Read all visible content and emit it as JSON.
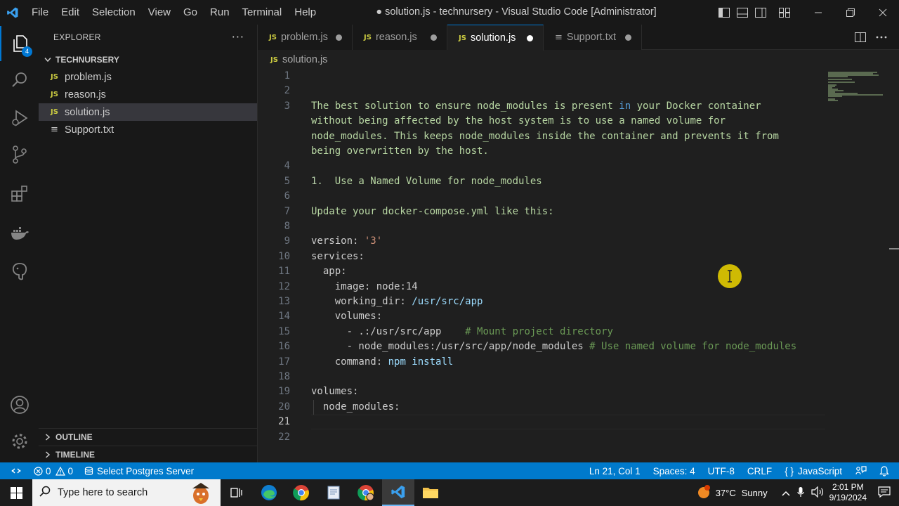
{
  "window": {
    "title": "● solution.js - technursery - Visual Studio Code [Administrator]",
    "menu": [
      "File",
      "Edit",
      "Selection",
      "View",
      "Go",
      "Run",
      "Terminal",
      "Help"
    ]
  },
  "activity_bar": {
    "explorer_badge": "4",
    "icons": [
      "files-icon",
      "search-icon",
      "run-debug-icon",
      "source-control-icon",
      "extensions-icon",
      "docker-icon",
      "postgres-icon",
      "account-icon",
      "manage-gear-icon"
    ]
  },
  "sidebar": {
    "title": "EXPLORER",
    "more": "···",
    "folder": "TECHNURSERY",
    "files": [
      {
        "icon": "JS",
        "name": "problem.js"
      },
      {
        "icon": "JS",
        "name": "reason.js"
      },
      {
        "icon": "JS",
        "name": "solution.js",
        "selected": true
      },
      {
        "icon": "≡",
        "name": "Support.txt"
      }
    ],
    "outline": "OUTLINE",
    "timeline": "TIMELINE"
  },
  "tabs": [
    {
      "icon": "JS",
      "label": "problem.js",
      "active": false
    },
    {
      "icon": "JS",
      "label": "reason.js",
      "active": false
    },
    {
      "icon": "JS",
      "label": "solution.js",
      "active": true
    },
    {
      "icon": "≡",
      "label": "Support.txt",
      "active": false
    }
  ],
  "breadcrumb": {
    "icon": "JS",
    "file": "solution.js"
  },
  "editor": {
    "current_line": 21,
    "line_numbers": [
      "1",
      "2",
      "3",
      "",
      "",
      "",
      "4",
      "5",
      "6",
      "7",
      "8",
      "9",
      "10",
      "11",
      "12",
      "13",
      "14",
      "15",
      "16",
      "17",
      "18",
      "19",
      "20",
      "21",
      "22"
    ],
    "lines": {
      "l3a": "The best solution to ensure node_modules is present ",
      "l3_in": "in",
      "l3b": " your Docker container",
      "l3c": "without being affected by the host system is to use a named volume for",
      "l3d": "node_modules. This keeps node_modules inside the container and prevents it from",
      "l3e": "being overwritten by the host.",
      "l5_num": "1.",
      "l5_text": "  Use a Named Volume for node_modules",
      "l7": "Update your docker-compose.yml like this:",
      "l9_key": "version:",
      "l9_val": " '3'",
      "l10": "services:",
      "l11": "  app:",
      "l12_key": "    image:",
      "l12_val": " node:14",
      "l13_key": "    working_dir:",
      "l13_val": " /usr/src/app",
      "l14": "    volumes:",
      "l15_a": "      - .:/usr/src/app    ",
      "l15_c": "# Mount project directory",
      "l16_a": "      - node_modules:/usr/src/app/node_modules ",
      "l16_c": "# Use named volume for node_modules",
      "l17_key": "    command:",
      "l17_val": " npm install",
      "l19": "volumes:",
      "l20": "  node_modules:"
    }
  },
  "statusbar": {
    "problems_errors": "0",
    "problems_warnings": "0",
    "postgres": "Select Postgres Server",
    "position": "Ln 21, Col 1",
    "spaces": "Spaces: 4",
    "encoding": "UTF-8",
    "eol": "CRLF",
    "language_icon": "{ }",
    "language": "JavaScript"
  },
  "taskbar": {
    "search_placeholder": "Type here to search",
    "weather_temp": "37°C",
    "weather_text": "Sunny",
    "time": "2:01 PM",
    "date": "9/19/2024"
  },
  "colors": {
    "accent": "#0078d4",
    "statusbar": "#007acc",
    "prose_text": "#b8d7a3",
    "comment": "#6a9955",
    "js_icon": "#cbcb41"
  }
}
